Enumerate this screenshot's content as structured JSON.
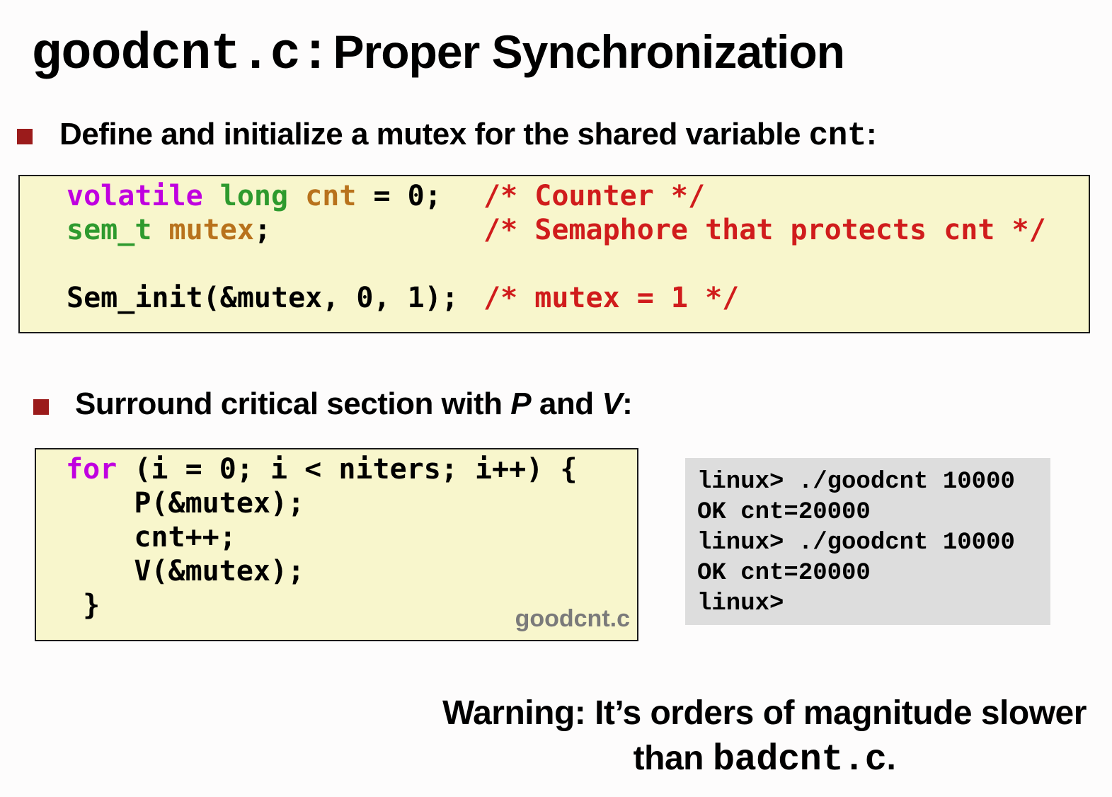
{
  "title": {
    "code": "goodcnt.c:",
    "text": "Proper Synchronization"
  },
  "bullet1": {
    "text": "Define and initialize a mutex for the shared variable ",
    "code": "cnt",
    "suffix": ":"
  },
  "code_block1": {
    "line1": {
      "kw": "volatile",
      "ty": "long",
      "id": "cnt",
      "rest": " = 0;",
      "comment": "/* Counter */"
    },
    "line2": {
      "ty": "sem_t",
      "id": "mutex",
      "rest": ";",
      "comment": "/* Semaphore that protects cnt */"
    },
    "line4": {
      "code": "Sem_init(&mutex, 0, 1);",
      "comment": "/* mutex = 1 */"
    }
  },
  "bullet2": {
    "prefix": "Surround critical section with ",
    "p": "P",
    "middle": " and ",
    "v": "V",
    "suffix": ":"
  },
  "code_block2": {
    "for_kw": "for",
    "for_rest": " (i = 0; i < niters; i++) {",
    "line2": "    P(&mutex);",
    "line3": "    cnt++;",
    "line4": "    V(&mutex);",
    "line5": " }",
    "file_label": "goodcnt.c"
  },
  "terminal": {
    "lines": [
      "linux> ./goodcnt 10000",
      "OK cnt=20000",
      "linux> ./goodcnt 10000",
      "OK cnt=20000",
      "linux>"
    ]
  },
  "warning": {
    "line1": "Warning: It’s orders of magnitude slower",
    "line2_prefix": "than ",
    "line2_code": "badcnt.c",
    "line2_suffix": "."
  },
  "colors": {
    "keyword": "#c000e0",
    "type": "#2e9a2e",
    "identifier": "#b8721c",
    "comment": "#d01c1c",
    "code_bg": "#f8f6cc",
    "terminal_bg": "#dddddd",
    "bullet": "#9b1b1b"
  }
}
